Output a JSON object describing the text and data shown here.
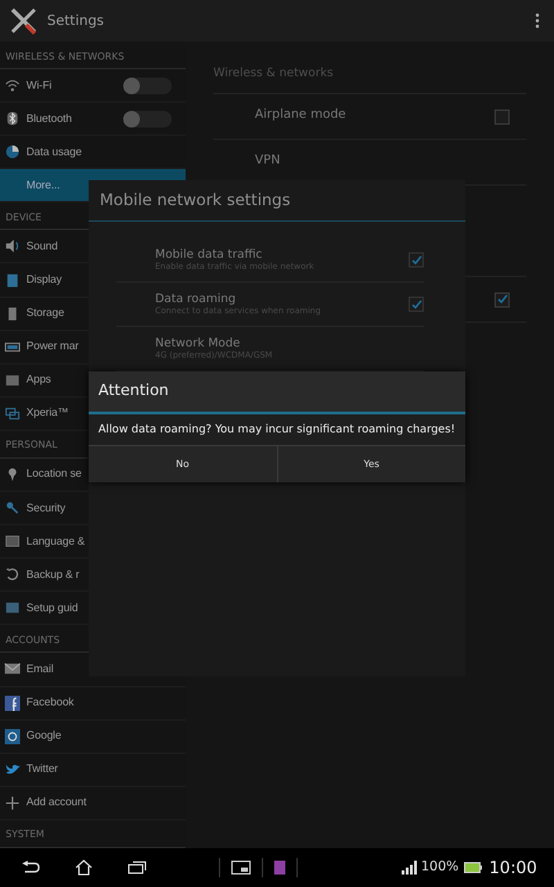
{
  "action_bar": {
    "title": "Settings"
  },
  "sidebar": {
    "sections": [
      {
        "header": "WIRELESS & NETWORKS",
        "items": [
          {
            "label": "Wi-Fi",
            "kind": "toggle",
            "on": false,
            "selected": false
          },
          {
            "label": "Bluetooth",
            "kind": "toggle",
            "on": false,
            "selected": false
          },
          {
            "label": "Data usage",
            "kind": "link",
            "selected": false
          },
          {
            "label": "More...",
            "kind": "link",
            "selected": true
          }
        ]
      },
      {
        "header": "DEVICE",
        "items": [
          {
            "label": "Sound",
            "kind": "link",
            "selected": false
          },
          {
            "label": "Display",
            "kind": "link",
            "selected": false
          },
          {
            "label": "Storage",
            "kind": "link",
            "selected": false
          },
          {
            "label": "Power mar",
            "kind": "link",
            "selected": false
          },
          {
            "label": "Apps",
            "kind": "link",
            "selected": false
          },
          {
            "label": "Xperia™",
            "kind": "link",
            "selected": false
          }
        ]
      },
      {
        "header": "PERSONAL",
        "items": [
          {
            "label": "Location se",
            "kind": "link",
            "selected": false
          },
          {
            "label": "Security",
            "kind": "link",
            "selected": false
          },
          {
            "label": "Language &",
            "kind": "link",
            "selected": false
          },
          {
            "label": "Backup & r",
            "kind": "link",
            "selected": false
          },
          {
            "label": "Setup guid",
            "kind": "link",
            "selected": false
          }
        ]
      },
      {
        "header": "ACCOUNTS",
        "items": [
          {
            "label": "Email",
            "kind": "link",
            "selected": false
          },
          {
            "label": "Facebook",
            "kind": "link",
            "selected": false
          },
          {
            "label": "Google",
            "kind": "link",
            "selected": false
          },
          {
            "label": "Twitter",
            "kind": "link",
            "selected": false
          },
          {
            "label": "Add account",
            "kind": "link",
            "selected": false
          }
        ]
      },
      {
        "header": "SYSTEM"
      }
    ]
  },
  "detail": {
    "header": "Wireless & networks",
    "rows": [
      {
        "label": "Airplane mode",
        "kind": "checkbox",
        "checked": false
      },
      {
        "label": "VPN",
        "kind": "link"
      },
      {
        "kind": "checkbox",
        "checked": true
      }
    ]
  },
  "mobile_network_dialog": {
    "title": "Mobile network settings",
    "items": [
      {
        "title": "Mobile data traffic",
        "summary": "Enable data traffic via mobile network",
        "kind": "checkbox",
        "checked": true
      },
      {
        "title": "Data roaming",
        "summary": "Connect to data services when roaming",
        "kind": "checkbox",
        "checked": true
      },
      {
        "title": "Network Mode",
        "summary": "4G (preferred)/WCDMA/GSM",
        "kind": "list"
      }
    ]
  },
  "attention_dialog": {
    "title": "Attention",
    "message": "Allow data roaming? You may incur significant roaming charges!",
    "buttons": [
      "No",
      "Yes"
    ]
  },
  "nav_bar": {
    "battery_text": "100%",
    "clock": "10:00"
  }
}
